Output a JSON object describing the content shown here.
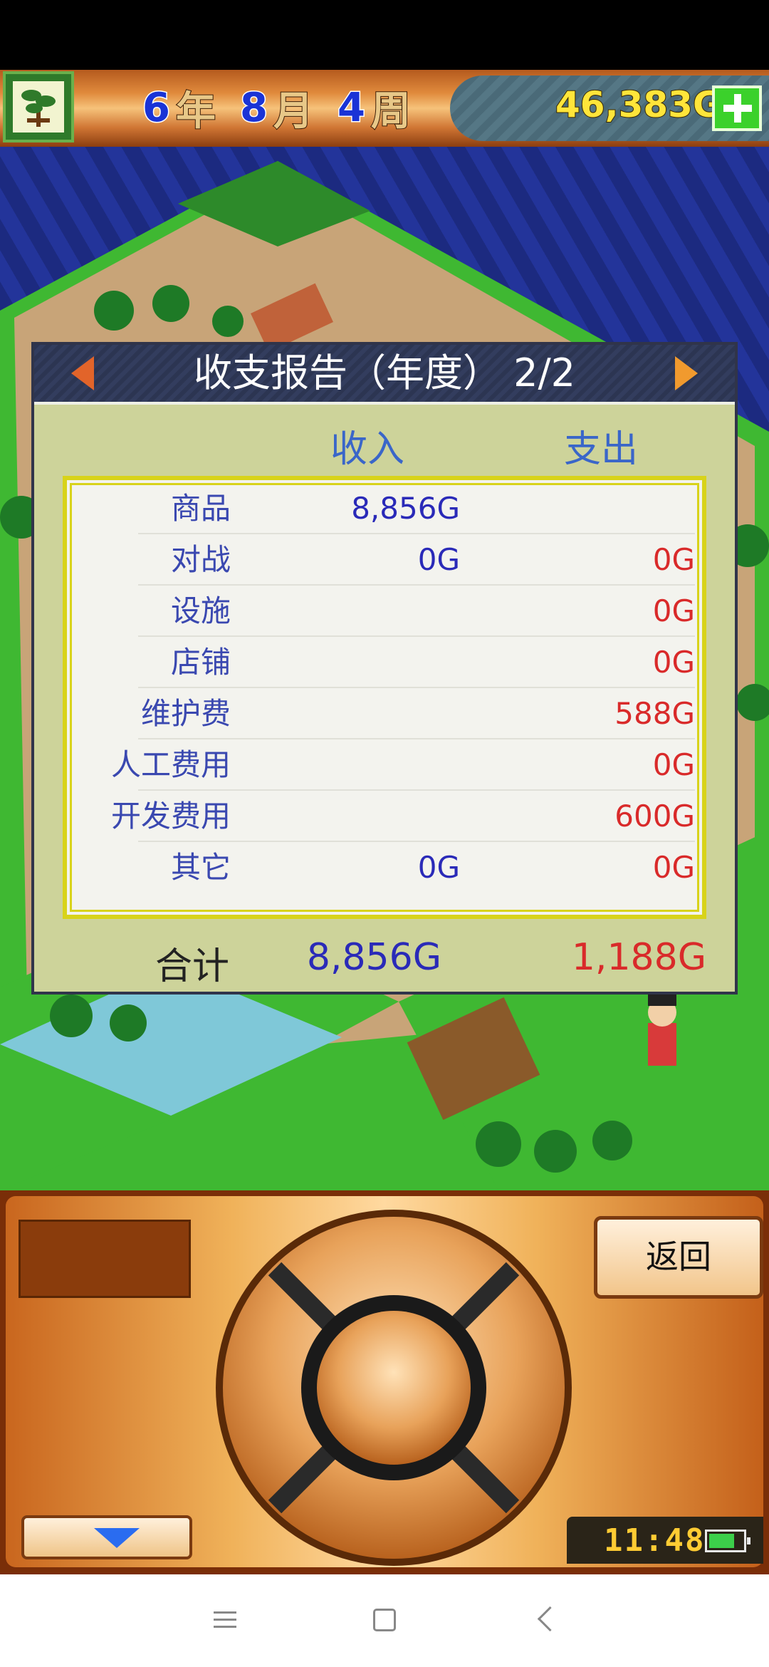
{
  "header": {
    "year_num": "6",
    "year_unit": "年",
    "month_num": "8",
    "month_unit": "月",
    "week_num": "4",
    "week_unit": "周",
    "money": "46,383G"
  },
  "report": {
    "title": "收支报告（年度） 2/2",
    "col_income": "收入",
    "col_expense": "支出",
    "rows": [
      {
        "label": "商品",
        "income": "8,856G",
        "expense": ""
      },
      {
        "label": "对战",
        "income": "0G",
        "expense": "0G"
      },
      {
        "label": "设施",
        "income": "",
        "expense": "0G"
      },
      {
        "label": "店铺",
        "income": "",
        "expense": "0G"
      },
      {
        "label": "维护费",
        "income": "",
        "expense": "588G"
      },
      {
        "label": "人工费用",
        "income": "",
        "expense": "0G"
      },
      {
        "label": "开发费用",
        "income": "",
        "expense": "600G"
      },
      {
        "label": "其它",
        "income": "0G",
        "expense": "0G"
      }
    ],
    "total_label": "合计",
    "total_income": "8,856G",
    "total_expense": "1,188G"
  },
  "controls": {
    "back_label": "返回",
    "clock": "11:48",
    "battery_level": 0.75
  },
  "icons": {
    "bonsai": "bonsai-tree-icon",
    "plus": "plus-icon",
    "prev": "arrow-left-icon",
    "next": "arrow-right-icon",
    "down": "arrow-down-icon",
    "battery": "battery-icon"
  },
  "colors": {
    "income": "#2a2ab8",
    "expense": "#d92a2a",
    "money": "#ffe53a",
    "dialog_bg": "#cdd39a"
  }
}
